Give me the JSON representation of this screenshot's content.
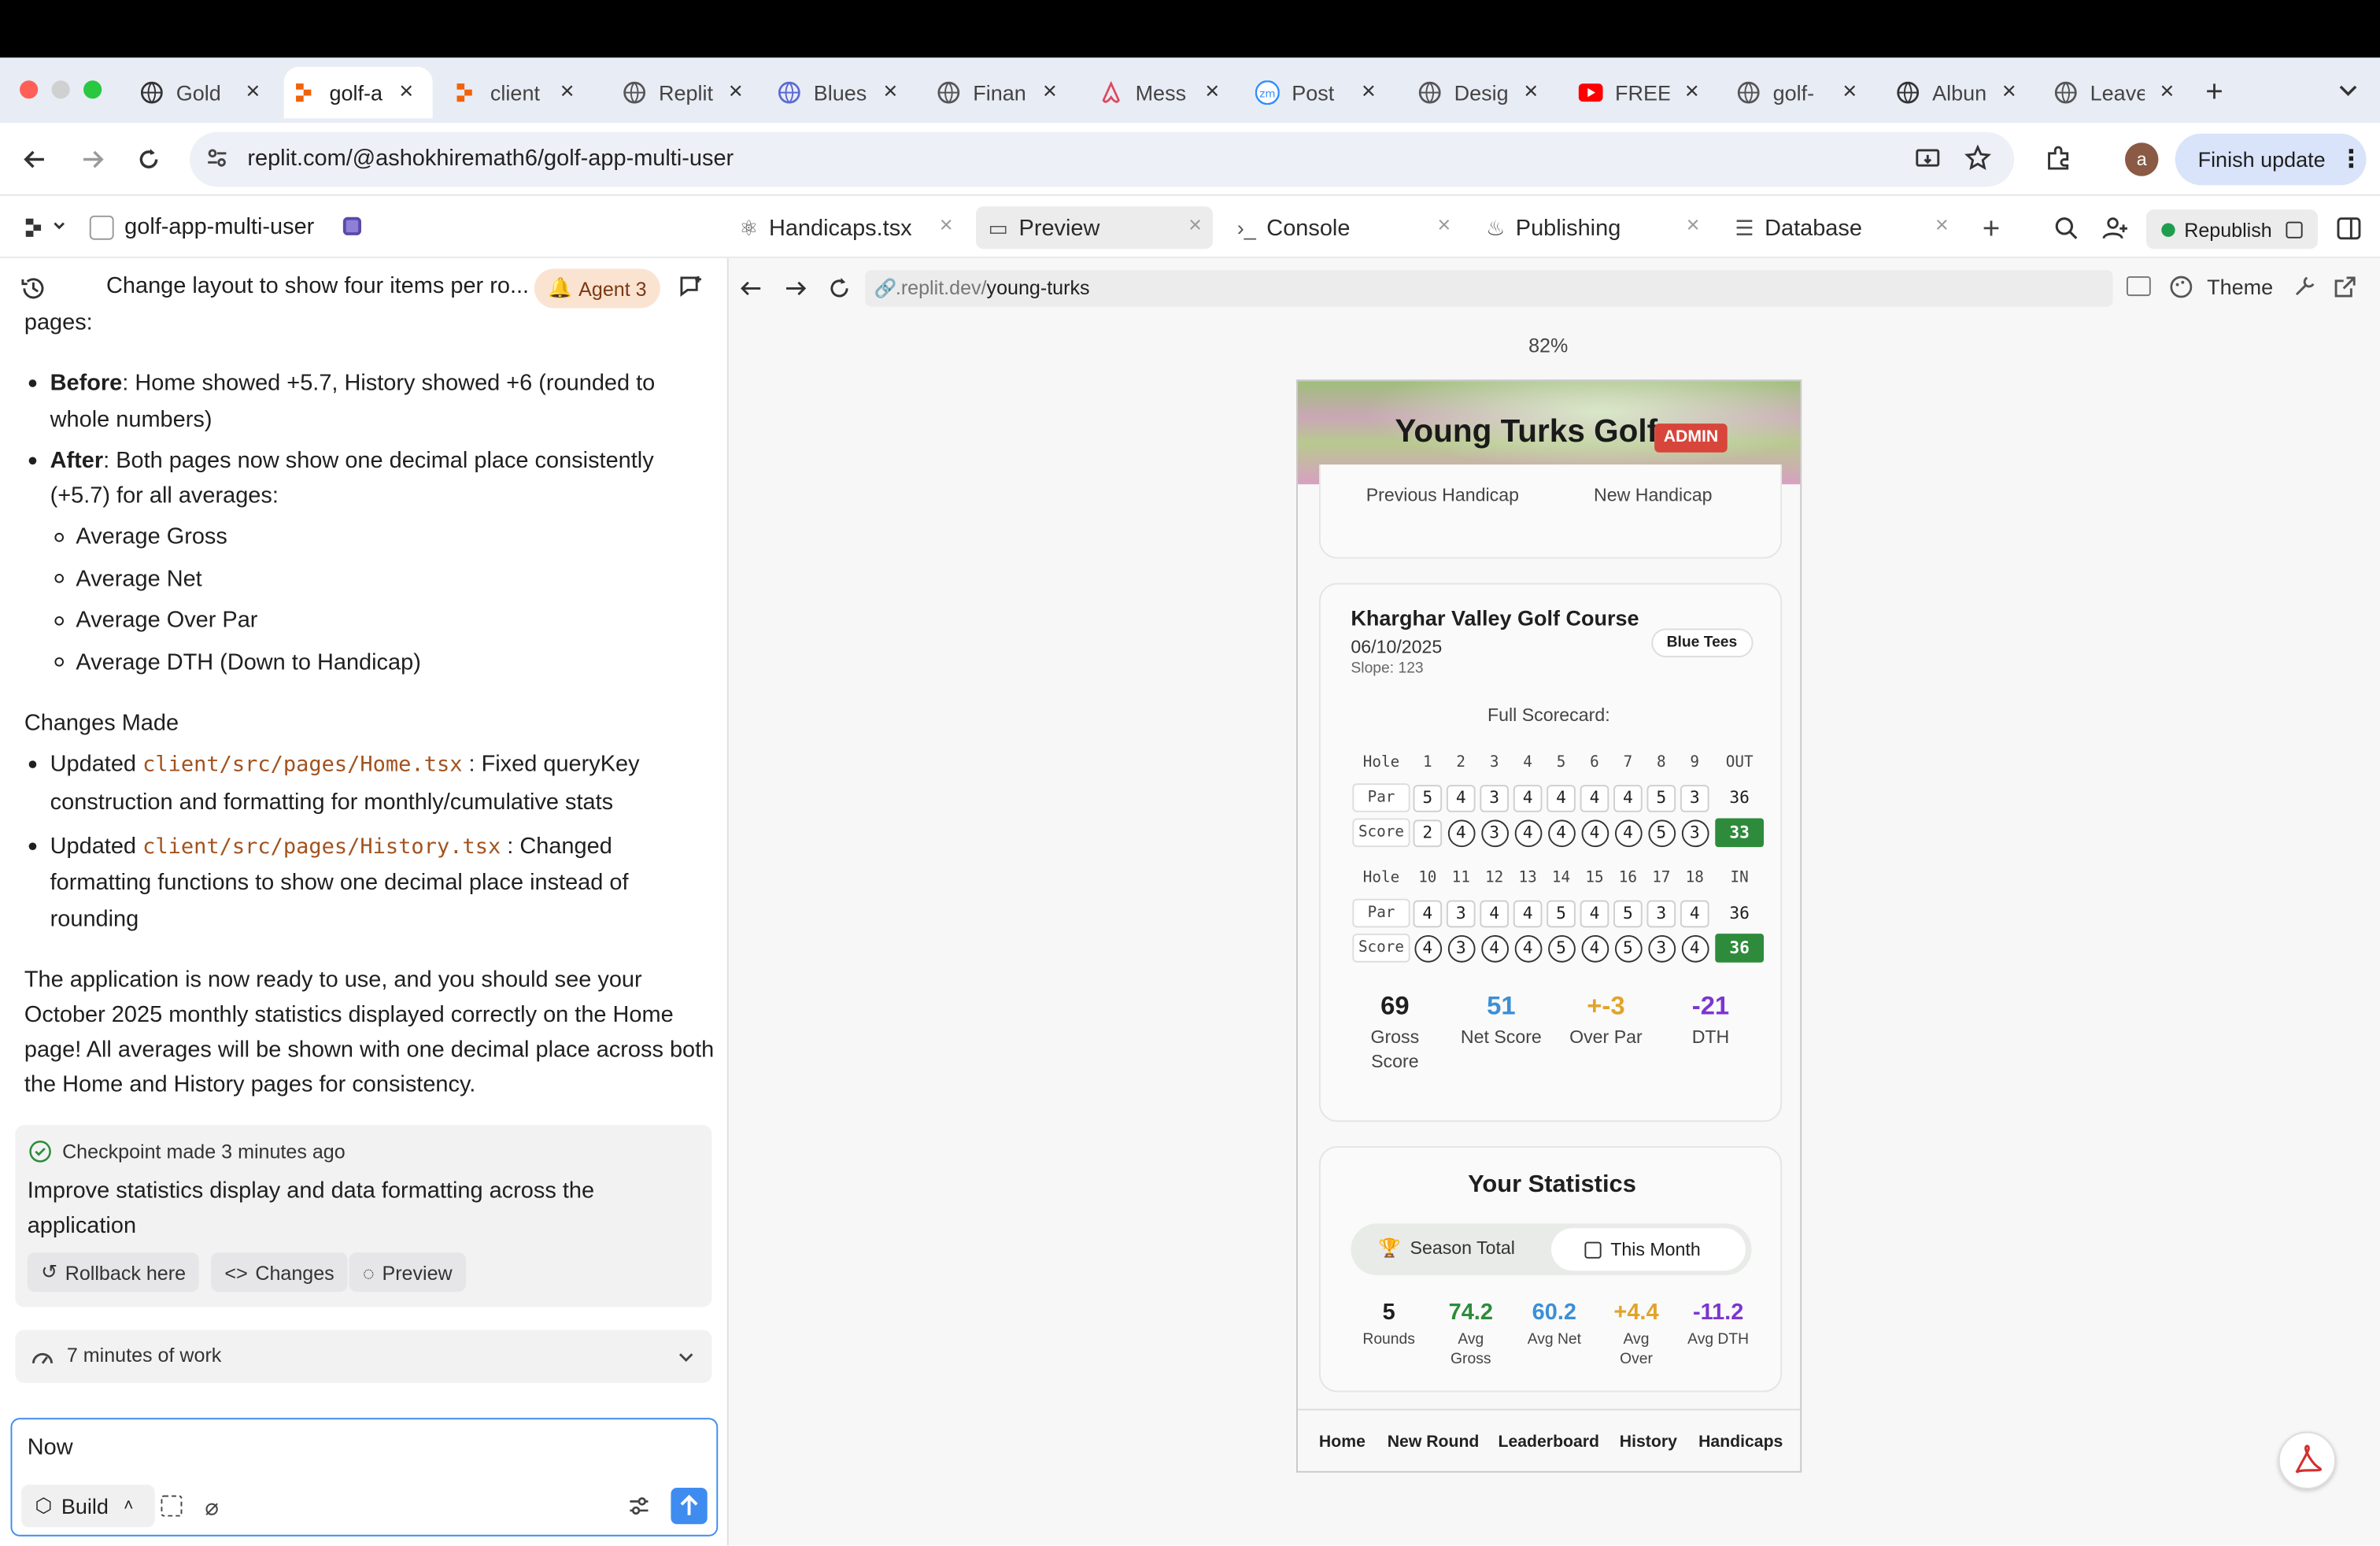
{
  "browser": {
    "tabs": [
      {
        "title": "Gold",
        "icon": "openai-icon"
      },
      {
        "title": "golf-a",
        "icon": "replit-icon",
        "active": true
      },
      {
        "title": "client",
        "icon": "replit-icon"
      },
      {
        "title": "Replit",
        "icon": "loading-icon"
      },
      {
        "title": "Blues",
        "icon": "blues-icon"
      },
      {
        "title": "Finan",
        "icon": "globe-icon"
      },
      {
        "title": "Mess",
        "icon": "airbnb-icon"
      },
      {
        "title": "Post",
        "icon": "zoom-icon"
      },
      {
        "title": "Desig",
        "icon": "globe-icon"
      },
      {
        "title": "FREE",
        "icon": "youtube-icon"
      },
      {
        "title": "golf-",
        "icon": "globe-icon"
      },
      {
        "title": "Albun",
        "icon": "openai-icon"
      },
      {
        "title": "Leave",
        "icon": "globe-icon"
      }
    ],
    "url": "replit.com/@ashokhiremath6/golf-app-multi-user",
    "profile_initial": "a",
    "finish_update": "Finish update"
  },
  "workspace": {
    "project_name": "golf-app-multi-user",
    "tabs": [
      {
        "label": "Handicaps.tsx",
        "icon": "react-icon"
      },
      {
        "label": "Preview",
        "icon": "monitor-icon",
        "active": true
      },
      {
        "label": "Console",
        "icon": "terminal-icon"
      },
      {
        "label": "Publishing",
        "icon": "publish-icon"
      },
      {
        "label": "Database",
        "icon": "database-icon"
      }
    ],
    "republish": "Republish"
  },
  "chat": {
    "thread_title": "Change layout to show four items per ro...",
    "agent_badge": "Agent 3",
    "intro": "pages:",
    "before_label": "Before",
    "before_text": ": Home showed +5.7, History showed +6 (rounded to",
    "before_text2": "whole numbers)",
    "after_label": "After",
    "after_text": ": Both pages now show one decimal place consistently",
    "after_text2": "(+5.7) for all averages:",
    "averages": [
      "Average Gross",
      "Average Net",
      "Average Over Par",
      "Average DTH (Down to Handicap)"
    ],
    "changes_heading": "Changes Made",
    "change1_prefix": "Updated",
    "change1_code": "client/src/pages/Home.tsx",
    "change1_text": ": Fixed queryKey",
    "change1_text2": "construction and formatting for monthly/cumulative stats",
    "change2_prefix": "Updated",
    "change2_code": "client/src/pages/History.tsx",
    "change2_text": ": Changed",
    "change2_text2": "formatting functions to show one decimal place instead of",
    "change2_text3": "rounding",
    "summary": [
      "The application is now ready to use, and you should see your",
      "October 2025 monthly statistics displayed correctly on the Home",
      "page! All averages will be shown with one decimal place across both",
      "the Home and History pages for consistency."
    ],
    "checkpoint_label": "Checkpoint made",
    "checkpoint_time": "3 minutes ago",
    "checkpoint_desc": [
      "Improve statistics display and data formatting across the",
      "application"
    ],
    "rollback": "Rollback here",
    "changes": "Changes",
    "preview": "Preview",
    "work_time": "7 minutes of work",
    "input_value": "Now",
    "build": "Build"
  },
  "preview": {
    "url_prefix": ".replit.dev/",
    "url_path": "young-turks",
    "theme": "Theme",
    "zoom": "82%",
    "app": {
      "title": "Young Turks Golf",
      "admin_badge": "ADMIN",
      "prev_handicap_label": "Previous Handicap",
      "new_handicap_label": "New Handicap",
      "course": "Kharghar Valley Golf Course",
      "date": "06/10/2025",
      "slope": "Slope: 123",
      "tees": "Blue Tees",
      "scorecard_title": "Full Scorecard:",
      "front": {
        "holes": [
          "Hole",
          "1",
          "2",
          "3",
          "4",
          "5",
          "6",
          "7",
          "8",
          "9",
          "OUT"
        ],
        "par": [
          "Par",
          "5",
          "4",
          "3",
          "4",
          "4",
          "4",
          "4",
          "5",
          "3",
          "36"
        ],
        "score": [
          "Score",
          "2",
          "4",
          "3",
          "4",
          "4",
          "4",
          "4",
          "5",
          "3",
          "33"
        ]
      },
      "back": {
        "holes": [
          "Hole",
          "10",
          "11",
          "12",
          "13",
          "14",
          "15",
          "16",
          "17",
          "18",
          "IN"
        ],
        "par": [
          "Par",
          "4",
          "3",
          "4",
          "4",
          "5",
          "4",
          "5",
          "3",
          "4",
          "36"
        ],
        "score": [
          "Score",
          "4",
          "3",
          "4",
          "4",
          "5",
          "4",
          "5",
          "3",
          "4",
          "36"
        ]
      },
      "round_stats": [
        {
          "value": "69",
          "label": "Gross",
          "label2": "Score",
          "color": "#1f1f1f"
        },
        {
          "value": "51",
          "label": "Net Score",
          "label2": "",
          "color": "#3b8fd6"
        },
        {
          "value": "+-3",
          "label": "Over Par",
          "label2": "",
          "color": "#e2a32a"
        },
        {
          "value": "-21",
          "label": "DTH",
          "label2": "",
          "color": "#7b35d1"
        }
      ],
      "stats_title": "Your Statistics",
      "toggle_season": "Season Total",
      "toggle_month": "This Month",
      "stats": [
        {
          "value": "5",
          "label": "Rounds",
          "label2": "",
          "color": "#1f1f1f"
        },
        {
          "value": "74.2",
          "label": "Avg",
          "label2": "Gross",
          "color": "#2e8b3b"
        },
        {
          "value": "60.2",
          "label": "Avg Net",
          "label2": "",
          "color": "#3b8fd6"
        },
        {
          "value": "+4.4",
          "label": "Avg",
          "label2": "Over",
          "color": "#e2a32a"
        },
        {
          "value": "-11.2",
          "label": "Avg DTH",
          "label2": "",
          "color": "#7b35d1"
        }
      ],
      "nav": [
        "Home",
        "New Round",
        "Leaderboard",
        "History",
        "Handicaps"
      ]
    }
  }
}
